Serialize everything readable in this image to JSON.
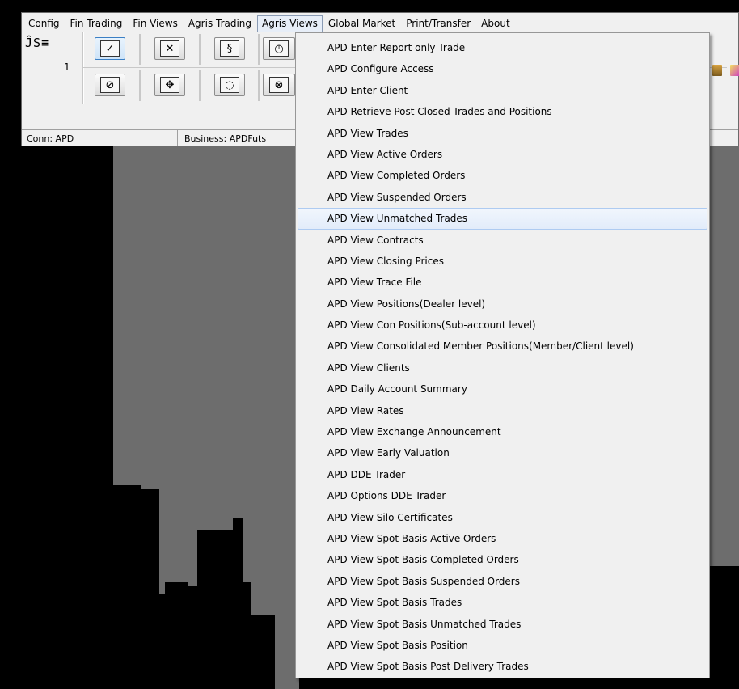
{
  "menubar": {
    "items": [
      "Config",
      "Fin Trading",
      "Fin Views",
      "Agris Trading",
      "Agris Views",
      "Global Market",
      "Print/Transfer",
      "About"
    ],
    "active": "Agris Views"
  },
  "toolbar": {
    "logo": "ĴS≡",
    "row_number": "1",
    "row1_icons": [
      "check-icon",
      "cancel-icon",
      "amend-icon",
      "clock-icon"
    ],
    "row2_icons": [
      "block-icon",
      "move-icon",
      "comment-icon",
      "clock-cancel-icon"
    ]
  },
  "status": {
    "conn": "Conn:  APD",
    "business": "Business: APDFuts"
  },
  "dropdown": {
    "hover_index": 8,
    "items": [
      "APD Enter Report only Trade",
      "APD Configure Access",
      "APD Enter Client",
      "APD Retrieve Post Closed Trades and Positions",
      "APD View Trades",
      "APD View Active Orders",
      "APD View Completed Orders",
      "APD View Suspended Orders",
      "APD View Unmatched Trades",
      "APD View Contracts",
      "APD View Closing Prices",
      "APD View Trace File",
      "APD View Positions(Dealer level)",
      "APD View Con Positions(Sub-account level)",
      "APD View Consolidated Member Positions(Member/Client level)",
      "APD View Clients",
      "APD Daily Account Summary",
      "APD View Rates",
      "APD View Exchange Announcement",
      "APD View Early Valuation",
      "APD DDE Trader",
      "APD Options DDE Trader",
      "APD View Silo Certificates",
      "APD View Spot Basis Active Orders",
      "APD View Spot Basis Completed Orders",
      "APD View Spot Basis Suspended Orders",
      "APD View Spot Basis Trades",
      "APD View Spot Basis Unmatched Trades",
      "APD View Spot Basis Position",
      "APD View Spot Basis Post Delivery Trades"
    ]
  },
  "colors": {
    "desktop": "#000000",
    "chart_fill": "#6d6d6d",
    "menu_bg": "#f0f0f0",
    "hover_border": "#aecbf1"
  }
}
